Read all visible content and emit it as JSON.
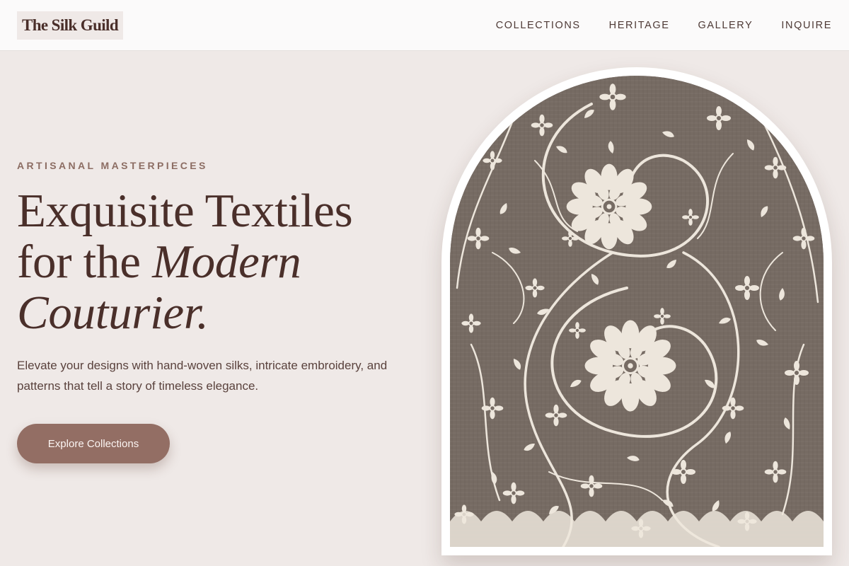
{
  "brand": {
    "name": "The Silk Guild"
  },
  "nav": {
    "items": [
      {
        "label": "COLLECTIONS"
      },
      {
        "label": "HERITAGE"
      },
      {
        "label": "GALLERY"
      },
      {
        "label": "INQUIRE"
      }
    ]
  },
  "hero": {
    "eyebrow": "ARTISANAL MASTERPIECES",
    "headline_line1": "Exquisite Textiles",
    "headline_line2_plain": "for the ",
    "headline_line2_italic": "Modern",
    "headline_line3_italic": "Couturier.",
    "subtitle": "Elevate your designs with hand-woven silks, intricate embroidery, and patterns that tell a story of timeless elegance.",
    "cta_label": "Explore Collections"
  },
  "image": {
    "subject": "embroidered textile with floral scroll pattern",
    "fabric_color": "#776c64",
    "motif_color": "#ede6dc"
  },
  "colors": {
    "background": "#efe9e7",
    "header": "#fbfafa",
    "text": "#4a2f2a",
    "accent": "#936e64",
    "eyebrow": "#8c6d63"
  }
}
